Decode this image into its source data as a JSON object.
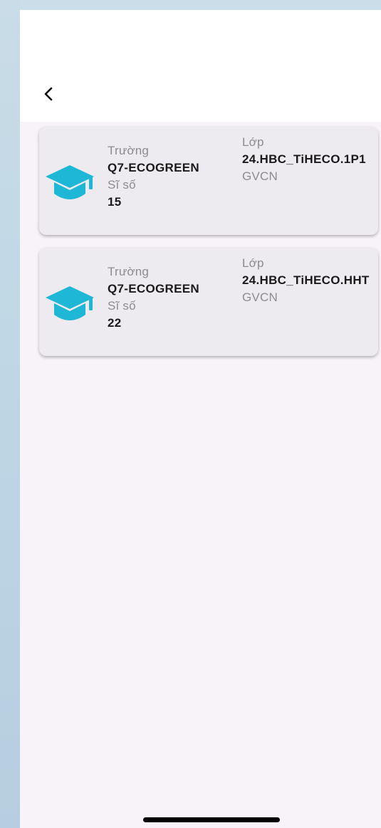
{
  "header": {
    "back_label": "Back"
  },
  "classes": [
    {
      "school_label": "Trường",
      "school_value": "Q7-ECOGREEN",
      "size_label": "Sĩ số",
      "size_value": "15",
      "class_label": "Lớp",
      "class_value": "24.HBC_TiHECO.1P1",
      "teacher_label": "GVCN"
    },
    {
      "school_label": "Trường",
      "school_value": "Q7-ECOGREEN",
      "size_label": "Sĩ số",
      "size_value": "22",
      "class_label": "Lớp",
      "class_value": "24.HBC_TiHECO.HHT",
      "teacher_label": "GVCN"
    }
  ],
  "colors": {
    "accent": "#1fb7d6",
    "card_bg": "#eeebf0",
    "page_bg": "#f7f3f9"
  },
  "icons": {
    "back": "chevron-left-icon",
    "class": "graduation-cap-icon"
  }
}
